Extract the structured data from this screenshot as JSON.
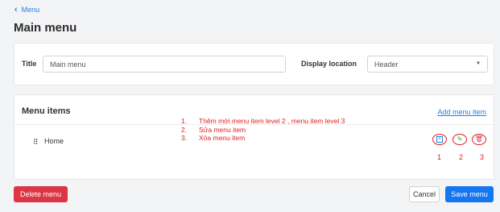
{
  "breadcrumb": {
    "back_label": "Menu"
  },
  "page": {
    "title": "Main menu"
  },
  "settings": {
    "title_label": "Title",
    "title_value": "Main menu",
    "display_location_label": "Display location",
    "display_location_value": "Header"
  },
  "menu_items": {
    "section_title": "Menu items",
    "add_link_label": "Add menu item",
    "rows": [
      {
        "label": "Home"
      }
    ]
  },
  "annotations": {
    "list": [
      {
        "num": "1.",
        "text": "Thêm mới menu item level 2  ,  menu item level 3"
      },
      {
        "num": "2.",
        "text": "Sửa menu item"
      },
      {
        "num": "3.",
        "text": "Xóa menu item"
      }
    ],
    "numbers": [
      "1",
      "2",
      "3"
    ]
  },
  "icons": {
    "handle": "drag-handle-icon",
    "add": "add-child-icon",
    "edit": "pencil-icon",
    "delete": "trash-icon"
  },
  "footer": {
    "delete_label": "Delete menu",
    "cancel_label": "Cancel",
    "save_label": "Save menu"
  },
  "colors": {
    "accent": "#1476f2",
    "danger": "#dc3545",
    "annotation": "#e02020",
    "edit_icon": "#28a745"
  }
}
